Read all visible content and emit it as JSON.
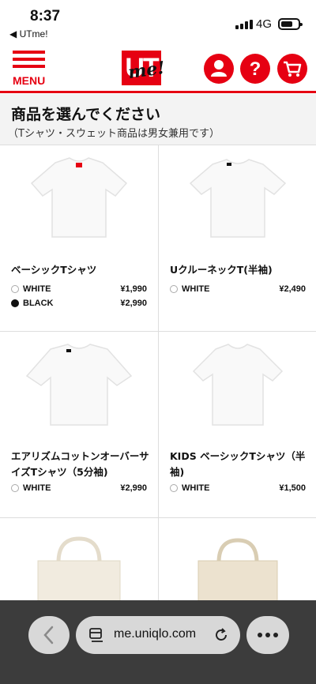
{
  "status": {
    "time": "8:37",
    "back_app": "◀ UTme!",
    "network": "4G"
  },
  "header": {
    "menu_label": "MENU",
    "logo_ut": "UT",
    "logo_me": "me!",
    "icons": [
      "user-icon",
      "help-icon",
      "cart-icon"
    ]
  },
  "section": {
    "title": "商品を選んでください",
    "subtitle": "（Tシャツ・スウェット商品は男女兼用です）"
  },
  "products": [
    {
      "name": "ベーシックTシャツ",
      "colors": [
        {
          "name": "WHITE",
          "price": "¥1,990",
          "swatch": "#ffffff"
        },
        {
          "name": "BLACK",
          "price": "¥2,990",
          "swatch": "#111111"
        }
      ]
    },
    {
      "name": "UクルーネックT(半袖)",
      "colors": [
        {
          "name": "WHITE",
          "price": "¥2,490",
          "swatch": "#ffffff"
        }
      ]
    },
    {
      "name": "エアリズムコットンオーバーサイズTシャツ（5分袖)",
      "colors": [
        {
          "name": "WHITE",
          "price": "¥2,990",
          "swatch": "#ffffff"
        }
      ]
    },
    {
      "name": "KIDS ベーシックTシャツ（半袖)",
      "colors": [
        {
          "name": "WHITE",
          "price": "¥1,500",
          "swatch": "#ffffff"
        }
      ]
    },
    {
      "name": "",
      "colors": []
    },
    {
      "name": "",
      "colors": []
    }
  ],
  "browser": {
    "url": "me.uniqlo.com"
  },
  "colors": {
    "brand_red": "#e60012",
    "section_bg": "#f3f3f3",
    "browser_bar": "#3c3c3c"
  }
}
